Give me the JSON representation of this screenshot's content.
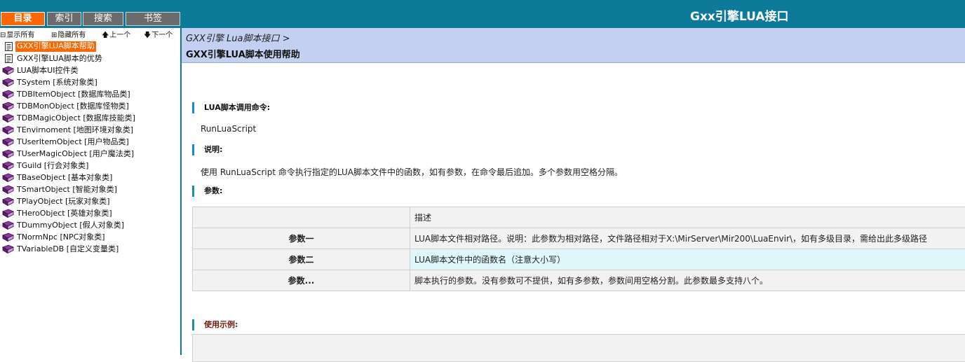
{
  "tabs": {
    "toc": "目录",
    "index": "索引",
    "search": "搜索",
    "bookmarks": "书签"
  },
  "toolbar": {
    "show_all": "显示所有",
    "hide_all": "隐藏所有",
    "prev": "上一个",
    "next": "下一个"
  },
  "tree": {
    "items": [
      {
        "label": "GXX引擎LUA脚本帮助",
        "icon": "document-icon",
        "selected": true
      },
      {
        "label": "GXX引擎LUA脚本的优势",
        "icon": "document-icon"
      },
      {
        "label": "LUA脚本UI控件类",
        "icon": "book-icon"
      },
      {
        "label": "TSystem [系统对象类]",
        "icon": "book-icon"
      },
      {
        "label": "TDBItemObject [数据库物品类]",
        "icon": "book-icon"
      },
      {
        "label": "TDBMonObject [数据库怪物类]",
        "icon": "book-icon"
      },
      {
        "label": "TDBMagicObject [数据库技能类]",
        "icon": "book-icon"
      },
      {
        "label": "TEnvirnoment [地图环境对象类]",
        "icon": "book-icon"
      },
      {
        "label": "TUserItemObject [用户物品类]",
        "icon": "book-icon"
      },
      {
        "label": "TUserMagicObject [用户魔法类]",
        "icon": "book-icon"
      },
      {
        "label": "TGuild [行会对象类]",
        "icon": "book-icon"
      },
      {
        "label": "TBaseObject [基本对象类]",
        "icon": "book-icon"
      },
      {
        "label": "TSmartObject [智能对象类]",
        "icon": "book-icon"
      },
      {
        "label": "TPlayObject [玩家对象类]",
        "icon": "book-icon"
      },
      {
        "label": "THeroObject [英雄对象类]",
        "icon": "book-icon"
      },
      {
        "label": "TDummyObject [假人对象类]",
        "icon": "book-icon"
      },
      {
        "label": "TNormNpc [NPC对象类]",
        "icon": "book-icon"
      },
      {
        "label": "TVariableDB [自定义变量类]",
        "icon": "book-icon"
      }
    ]
  },
  "banner": {
    "title": "Gxx引擎LUA接口"
  },
  "header": {
    "breadcrumb": "GXX引擎 Lua脚本接口 >",
    "title": "GXX引擎LUA脚本使用帮助"
  },
  "content": {
    "command_heading": "LUA脚本调用命令:",
    "command": "RunLuaScript",
    "desc_heading": "说明:",
    "description": "使用 RunLuaScript 命令执行指定的LUA脚本文件中的函数，如有参数，在命令最后追加。多个参数用空格分隔。",
    "params_heading": "参数:",
    "example_heading": "使用示例:"
  },
  "params_table": {
    "header": {
      "name": "",
      "desc": "描述"
    },
    "rows": [
      {
        "name": "参数一",
        "desc": "LUA脚本文件相对路径。说明：此参数为相对路径，文件路径相对于X:\\MirServer\\Mir200\\LuaEnvir\\，如有多级目录，需给出此多级路径"
      },
      {
        "name": "参数二",
        "desc": "LUA脚本文件中的函数名（注意大小写）"
      },
      {
        "name": "参数...",
        "desc": "脚本执行的参数。没有参数可不提供，如有多参数，参数间用空格分割。此参数最多支持八个。"
      }
    ]
  },
  "colors": {
    "banner": "#0d7a9a",
    "active_tab": "#ff6600",
    "header_band": "#c4d0f1",
    "accent_bar": "#1a8bb9",
    "highlight_row": "#dff6fb"
  }
}
